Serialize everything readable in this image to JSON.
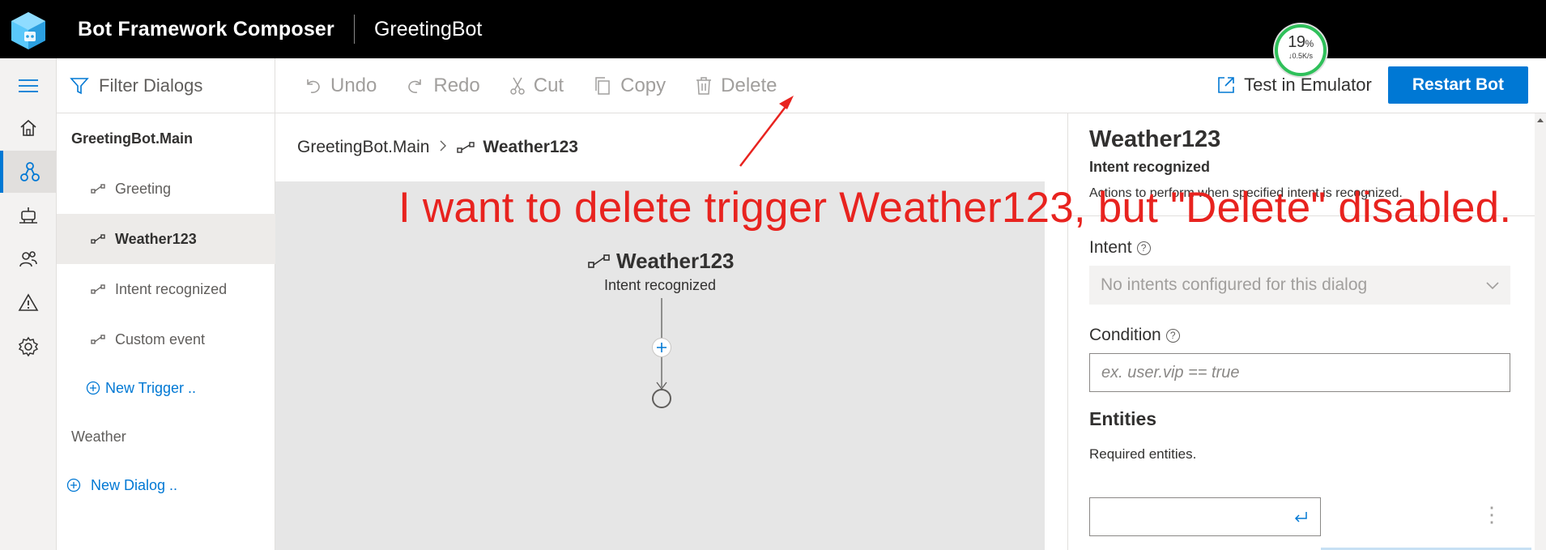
{
  "header": {
    "app_title": "Bot Framework Composer",
    "bot_name": "GreetingBot"
  },
  "sidebar": {
    "filter_label": "Filter Dialogs",
    "items": [
      {
        "label": "GreetingBot.Main",
        "type": "dialog"
      },
      {
        "label": "Greeting",
        "type": "trigger"
      },
      {
        "label": "Weather123",
        "type": "trigger",
        "selected": true
      },
      {
        "label": "Intent recognized",
        "type": "trigger"
      },
      {
        "label": "Custom event",
        "type": "trigger"
      },
      {
        "label": "New Trigger ..",
        "type": "action"
      },
      {
        "label": "Weather",
        "type": "dialog"
      },
      {
        "label": "New Dialog ..",
        "type": "action"
      }
    ]
  },
  "toolbar": {
    "undo": "Undo",
    "redo": "Redo",
    "cut": "Cut",
    "copy": "Copy",
    "delete": "Delete",
    "test_emulator": "Test in Emulator",
    "restart_bot": "Restart Bot"
  },
  "breadcrumb": {
    "parent": "GreetingBot.Main",
    "current": "Weather123"
  },
  "canvas": {
    "node_title": "Weather123",
    "node_subtitle": "Intent recognized"
  },
  "panel": {
    "title": "Weather123",
    "subtitle": "Intent recognized",
    "description": "Actions to perform when specified intent is recognized.",
    "intent_label": "Intent",
    "intent_placeholder": "No intents configured for this dialog",
    "condition_label": "Condition",
    "condition_placeholder": "ex. user.vip == true",
    "entities_heading": "Entities",
    "entities_text": "Required entities."
  },
  "speed_widget": {
    "percent": "19",
    "percent_unit": "%",
    "rate": "↓0.5K/s"
  },
  "annotation": {
    "text": "I want to delete trigger Weather123, but \"Delete\" disabled.",
    "color": "#e8231f"
  },
  "colors": {
    "accent": "#0078d4",
    "header_bg": "#000000",
    "canvas_bg": "#e6e6e6"
  }
}
